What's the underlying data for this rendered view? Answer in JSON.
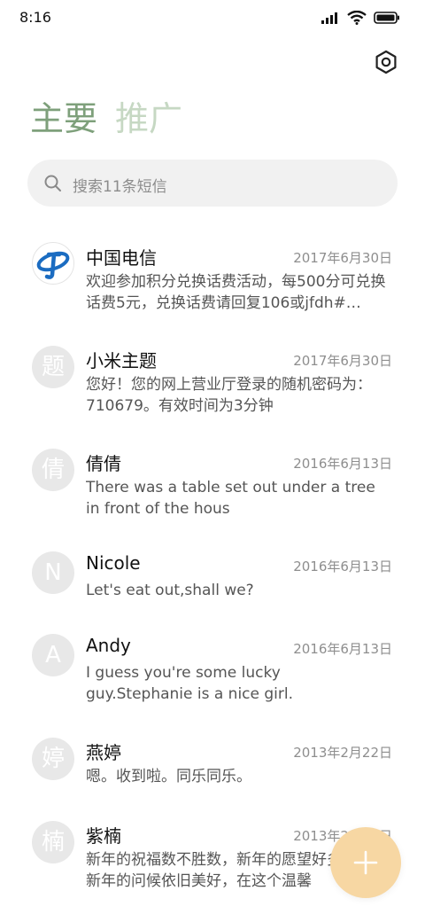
{
  "status_bar": {
    "time": "8:16"
  },
  "header": {
    "tabs": [
      {
        "label": "主要",
        "active": true
      },
      {
        "label": "推广",
        "active": false
      }
    ],
    "settings_icon": "settings-hexagon-icon"
  },
  "search": {
    "placeholder": "搜索11条短信"
  },
  "messages": [
    {
      "name": "中国电信",
      "date": "2017年6月30日",
      "preview": "欢迎参加积分兑换话费活动，每500分可兑换话费5元，兑换话费请回复106或jfdh#…",
      "avatar_type": "logo",
      "avatar_icon": "china-telecom-logo-icon"
    },
    {
      "name": "小米主题",
      "date": "2017年6月30日",
      "preview": "您好！您的网上营业厅登录的随机密码为：710679。有效时间为3分钟",
      "avatar": "题"
    },
    {
      "name": "倩倩",
      "date": "2016年6月13日",
      "preview": "There was a table set out under a tree in front of the hous",
      "avatar": "倩"
    },
    {
      "name": "Nicole",
      "date": "2016年6月13日",
      "preview": "Let's eat out,shall we?",
      "avatar": "N"
    },
    {
      "name": "Andy",
      "date": "2016年6月13日",
      "preview": "I guess you're some lucky guy.Stephanie is a nice girl.",
      "avatar": "A"
    },
    {
      "name": "燕婷",
      "date": "2013年2月22日",
      "preview": "嗯。收到啦。同乐同乐。",
      "avatar": "婷"
    },
    {
      "name": "紫楠",
      "date": "2013年2月22日",
      "preview": "新年的祝福数不胜数，新年的愿望好多好多，新年的问候依旧美好，在这个温馨",
      "avatar": "楠"
    }
  ],
  "fab": {
    "icon": "plus-icon",
    "color": "#f7d7a3"
  },
  "colors": {
    "accent": "#7ea07b",
    "accent_light": "#c6d8c3"
  }
}
